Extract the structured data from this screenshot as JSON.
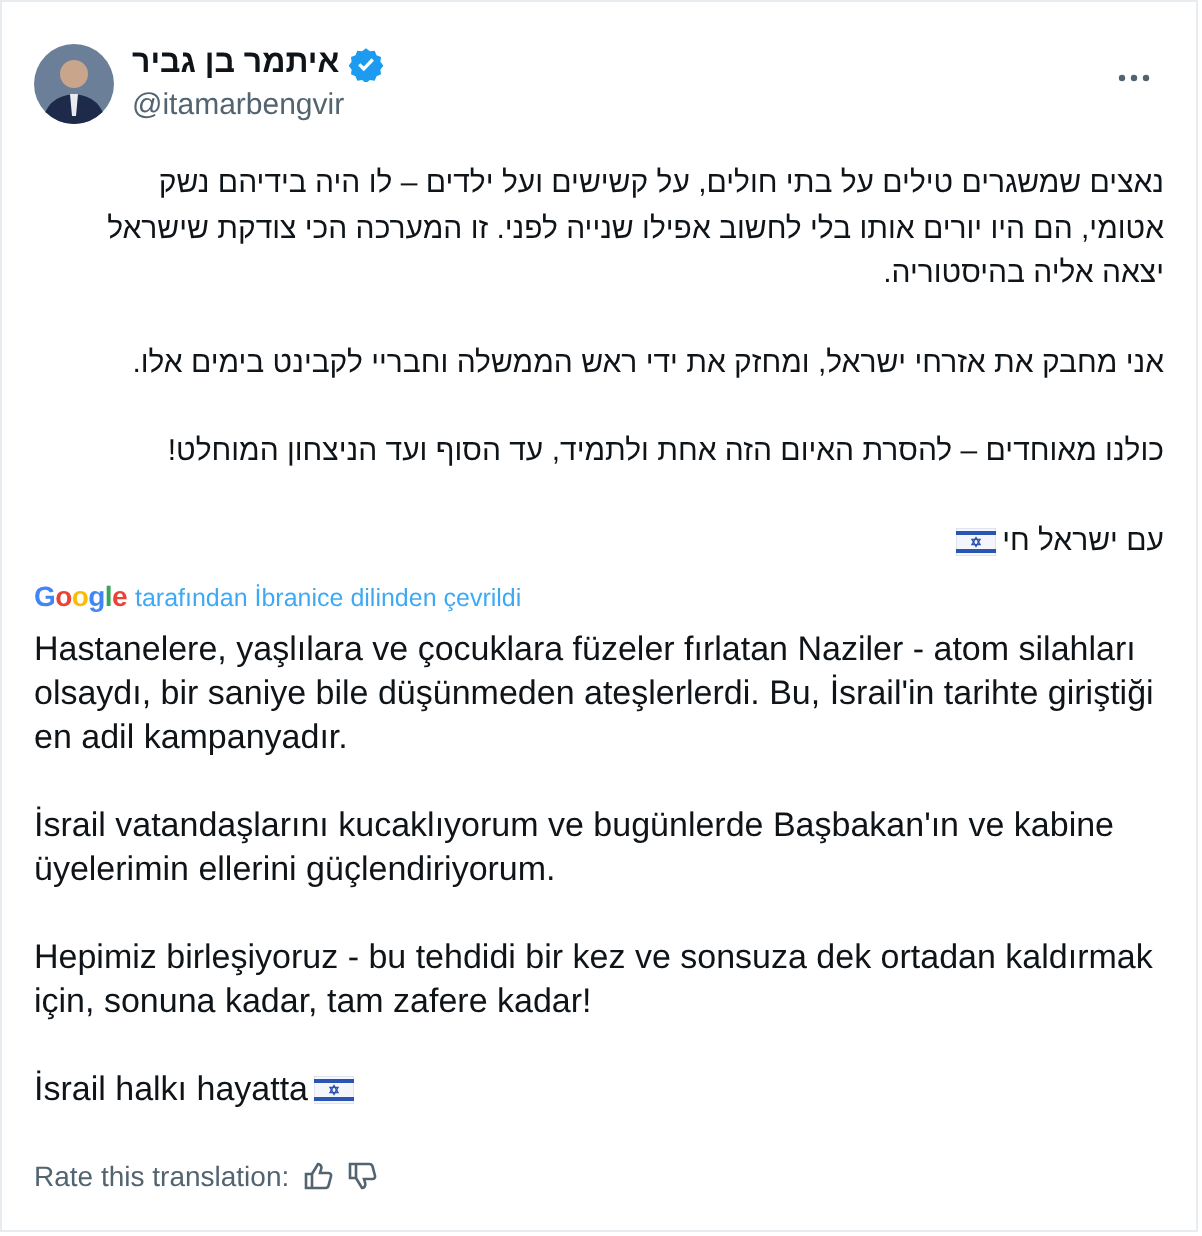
{
  "author": {
    "name": "איתמר בן גביר",
    "verified": true,
    "handle": "@itamarbengvir"
  },
  "original": {
    "paragraphs": [
      "נאצים שמשגרים טילים על בתי חולים, על קשישים ועל ילדים – לו היה בידיהם נשק אטומי, הם היו יורים אותו בלי לחשוב אפילו שנייה לפני. זו המערכה הכי צודקת שישראל יצאה אליה בהיסטוריה.",
      "אני מחבק את אזרחי ישראל, ומחזק את ידי ראש הממשלה וחבריי לקבינט בימים אלו.",
      "כולנו מאוחדים – להסרת האיום הזה אחת ולתמיד, עד הסוף ועד הניצחון המוחלט!"
    ],
    "closing": "עם ישראל חי"
  },
  "translation_note": {
    "brand": "Google",
    "text": "tarafından İbranice dilinden çevrildi"
  },
  "translation": {
    "paragraphs": [
      "Hastanelere, yaşlılara ve çocuklara füzeler fırlatan Naziler - atom silahları olsaydı, bir saniye bile düşünmeden ateşlerlerdi. Bu, İsrail'in tarihte giriştiği en adil kampanyadır.",
      "İsrail vatandaşlarını kucaklıyorum ve bugünlerde Başbakan'ın ve kabine üyelerimin ellerini güçlendiriyorum.",
      "Hepimiz birleşiyoruz - bu tehdidi bir kez ve sonsuza dek ortadan kaldırmak için, sonuna kadar, tam zafere kadar!"
    ],
    "closing": "İsrail halkı hayatta"
  },
  "rating": {
    "label": "Rate this translation:"
  }
}
